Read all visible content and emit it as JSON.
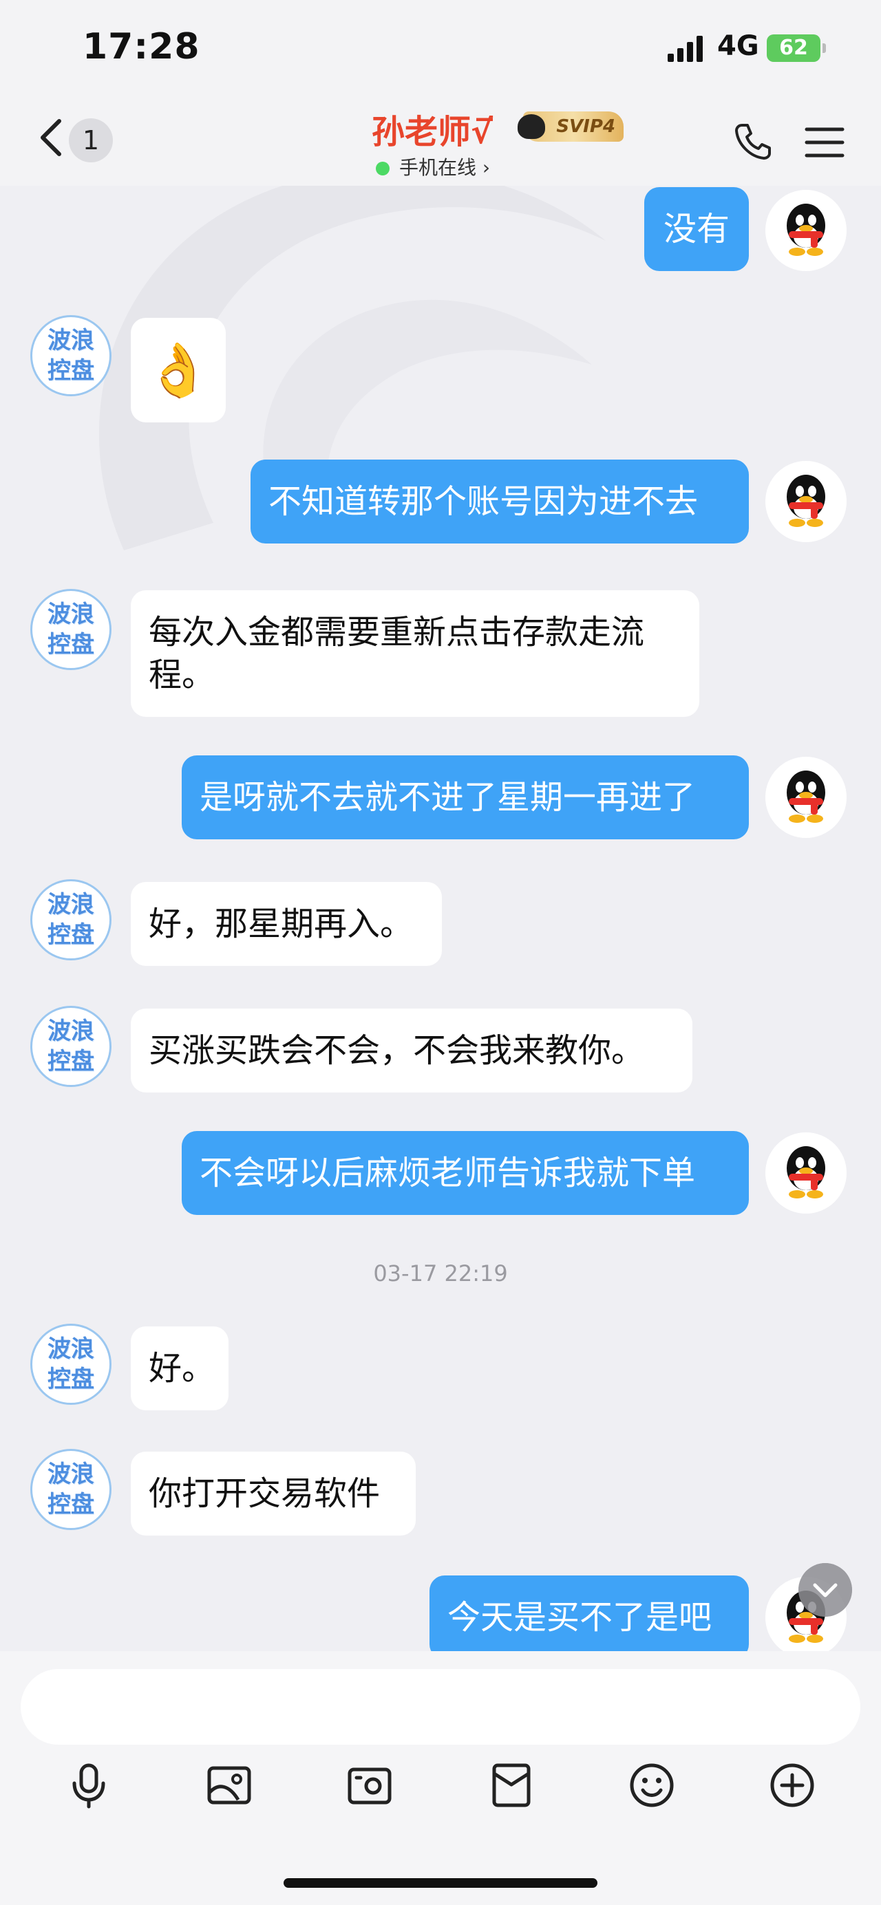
{
  "status_bar": {
    "time": "17:28",
    "network": "4G",
    "battery": "62"
  },
  "header": {
    "unread_count": "1",
    "contact_name": "孙老师√̅",
    "vip_label": "SVIP4",
    "online_status": "手机在线 ›"
  },
  "chat": {
    "teacher_avatar_text": "波浪\n控盘",
    "messages": [
      {
        "side": "out",
        "text": "没有"
      },
      {
        "side": "in",
        "text": "👌",
        "kind": "emoji"
      },
      {
        "side": "out",
        "text": "不知道转那个账号因为进不去"
      },
      {
        "side": "in",
        "line1": "每次入金都需要重新点击存款走流",
        "line2": "程。"
      },
      {
        "side": "out",
        "text": "是呀就不去就不进了星期一再进了"
      },
      {
        "side": "in",
        "text": "好，那星期再入。"
      },
      {
        "side": "in",
        "text": "买涨买跌会不会，不会我来教你。"
      },
      {
        "side": "out",
        "text": "不会呀以后麻烦老师告诉我就下单"
      },
      {
        "side": "in",
        "text": "好。"
      },
      {
        "side": "in",
        "text": "你打开交易软件"
      },
      {
        "side": "out",
        "text": "今天是买不了是吧"
      }
    ],
    "timestamp": "03-17 22:19"
  },
  "toolbar": {
    "icons": [
      "microphone-icon",
      "image-icon",
      "camera-icon",
      "red-packet-icon",
      "emoji-icon",
      "plus-icon"
    ]
  },
  "colors": {
    "out_bubble": "#3fa3f7",
    "in_bubble": "#ffffff",
    "name": "#e8452c"
  }
}
